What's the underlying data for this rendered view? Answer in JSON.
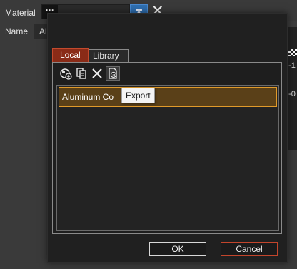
{
  "background": {
    "material_label": "Material",
    "material_button": "···",
    "name_label": "Name",
    "name_value": "Al",
    "close_symbol": "✕",
    "right_panel": {
      "text1": ":-1",
      "text2": ":-0"
    }
  },
  "dialog": {
    "tabs": [
      {
        "label": "Local",
        "active": true
      },
      {
        "label": "Library",
        "active": false
      }
    ],
    "toolbar": [
      {
        "icon": "sphere-add-icon",
        "tooltip": ""
      },
      {
        "icon": "copy-icon",
        "tooltip": ""
      },
      {
        "icon": "delete-icon",
        "tooltip": ""
      },
      {
        "icon": "export-icon",
        "tooltip": "Export"
      }
    ],
    "list_items": [
      {
        "label": "Aluminum Co",
        "selected": true
      }
    ],
    "tooltip": "Export",
    "ok_label": "OK",
    "cancel_label": "Cancel"
  },
  "colors": {
    "accent_active_tab": "#8a2b17",
    "selection_border": "#e09a2a",
    "cancel_border": "#c3452c",
    "picker_blue": "#2f6fb1"
  }
}
